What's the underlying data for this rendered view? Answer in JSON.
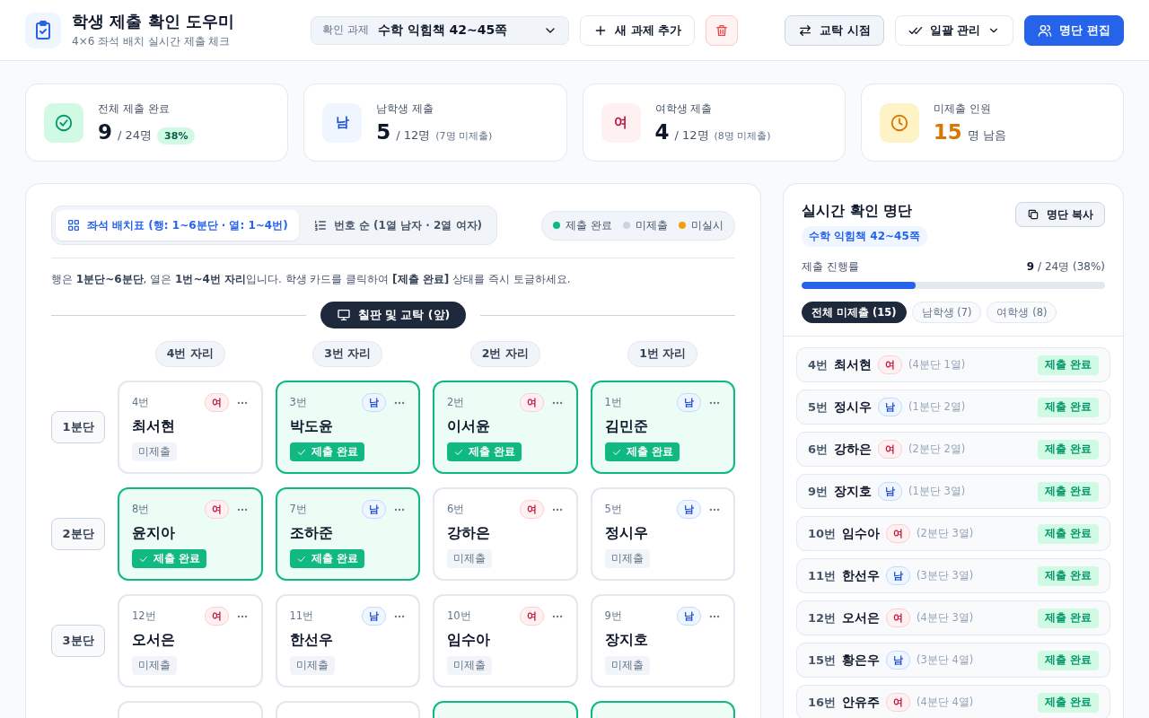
{
  "header": {
    "title": "학생 제출 확인 도우미",
    "subtitle": "4×6 좌석 배치 실시간 제출 체크",
    "assignment_select": {
      "label": "확인 과제",
      "value": "수학 익힘책 42~45쪽"
    },
    "buttons": [
      {
        "kind": "outline",
        "label": "새 과제 추가"
      },
      {
        "kind": "danger"
      },
      {
        "kind": "spacer"
      },
      {
        "kind": "soft",
        "label": "교탁 시점"
      },
      {
        "kind": "dropdown",
        "label": "일괄 관리"
      },
      {
        "kind": "primary",
        "label": "명단 편집"
      }
    ]
  },
  "stats": [
    {
      "kind": "check",
      "label": "전체 제출 완료",
      "value": "9",
      "total": "/ 24명",
      "percent": "38%"
    },
    {
      "kind": "male",
      "badge": "남",
      "label": "남학생 제출",
      "value": "5",
      "total": "/ 12명",
      "note": "(7명 미제출)"
    },
    {
      "kind": "female",
      "badge": "여",
      "label": "여학생 제출",
      "value": "4",
      "total": "/ 12명",
      "note": "(8명 미제출)"
    },
    {
      "kind": "clock",
      "label": "미제출 인원",
      "value": "15",
      "total": "명 남음"
    }
  ],
  "seating": {
    "view_tabs": [
      {
        "kind": "grid",
        "label": "좌석 배치표 (행: 1~6분단 · 열: 1~4번)",
        "selected": true
      },
      {
        "kind": "list",
        "label": "번호 순 (1열 남자 · 2열 여자)",
        "selected": false
      }
    ],
    "legend": [
      {
        "label": "제출 완료",
        "color": "#10b981"
      },
      {
        "label": "미제출",
        "color": "#cbd5e1"
      },
      {
        "label": "미실시",
        "color": "#f59e0b"
      }
    ],
    "instructions": "행은 **1분단~6분단**, 열은 **1번~4번 자리**입니다. 학생 카드를 클릭하여 **[제출 완료]** 상태를 즉시 토글하세요.",
    "front_label": "칠판 및 교탁 (앞)",
    "columns": [
      "4번 자리",
      "3번 자리",
      "2번 자리",
      "1번 자리"
    ],
    "rows": [
      {
        "label": "1분단",
        "seats": [
          {
            "number": "4번",
            "kind": "female",
            "badge": "여",
            "name": "최서현",
            "status": "미제출",
            "submitted": false
          },
          {
            "number": "3번",
            "kind": "male",
            "badge": "남",
            "name": "박도윤",
            "status": "제출 완료",
            "submitted": true
          },
          {
            "number": "2번",
            "kind": "female",
            "badge": "여",
            "name": "이서윤",
            "status": "제출 완료",
            "submitted": true
          },
          {
            "number": "1번",
            "kind": "male",
            "badge": "남",
            "name": "김민준",
            "status": "제출 완료",
            "submitted": true
          }
        ]
      },
      {
        "label": "2분단",
        "seats": [
          {
            "number": "8번",
            "kind": "female",
            "badge": "여",
            "name": "윤지아",
            "status": "제출 완료",
            "submitted": true
          },
          {
            "number": "7번",
            "kind": "male",
            "badge": "남",
            "name": "조하준",
            "status": "제출 완료",
            "submitted": true
          },
          {
            "number": "6번",
            "kind": "female",
            "badge": "여",
            "name": "강하은",
            "status": "미제출",
            "submitted": false
          },
          {
            "number": "5번",
            "kind": "male",
            "badge": "남",
            "name": "정시우",
            "status": "미제출",
            "submitted": false
          }
        ]
      },
      {
        "label": "3분단",
        "seats": [
          {
            "number": "12번",
            "kind": "female",
            "badge": "여",
            "name": "오서은",
            "status": "미제출",
            "submitted": false
          },
          {
            "number": "11번",
            "kind": "male",
            "badge": "남",
            "name": "한선우",
            "status": "미제출",
            "submitted": false
          },
          {
            "number": "10번",
            "kind": "female",
            "badge": "여",
            "name": "임수아",
            "status": "미제출",
            "submitted": false
          },
          {
            "number": "9번",
            "kind": "male",
            "badge": "남",
            "name": "장지호",
            "status": "미제출",
            "submitted": false
          }
        ]
      },
      {
        "seats": [
          {
            "submitted": false
          },
          {
            "submitted": false
          },
          {
            "submitted": true
          },
          {
            "submitted": true
          }
        ]
      }
    ]
  },
  "roster": {
    "title": "실시간 확인 명단",
    "copy_button": "명단 복사",
    "subject": "수학 익힘책 42~45쪽",
    "progress_label": "제출 진행률",
    "progress_text": "**9** / 24명 (38%)",
    "level": 0.375,
    "filters": [
      {
        "label": "전체 미제출 (15)",
        "selected": true
      },
      {
        "label": "남학생 (7)",
        "selected": false
      },
      {
        "label": "여학생 (8)",
        "selected": false
      }
    ],
    "items": [
      {
        "number": "4번",
        "name": "최서현",
        "kind": "female",
        "badge": "여",
        "seat": "(4분단 1열)",
        "action": "제출 완료"
      },
      {
        "number": "5번",
        "name": "정시우",
        "kind": "male",
        "badge": "남",
        "seat": "(1분단 2열)",
        "action": "제출 완료"
      },
      {
        "number": "6번",
        "name": "강하은",
        "kind": "female",
        "badge": "여",
        "seat": "(2분단 2열)",
        "action": "제출 완료"
      },
      {
        "number": "9번",
        "name": "장지호",
        "kind": "male",
        "badge": "남",
        "seat": "(1분단 3열)",
        "action": "제출 완료"
      },
      {
        "number": "10번",
        "name": "임수아",
        "kind": "female",
        "badge": "여",
        "seat": "(2분단 3열)",
        "action": "제출 완료"
      },
      {
        "number": "11번",
        "name": "한선우",
        "kind": "male",
        "badge": "남",
        "seat": "(3분단 3열)",
        "action": "제출 완료"
      },
      {
        "number": "12번",
        "name": "오서은",
        "kind": "female",
        "badge": "여",
        "seat": "(4분단 3열)",
        "action": "제출 완료"
      },
      {
        "number": "15번",
        "name": "황은우",
        "kind": "male",
        "badge": "남",
        "seat": "(3분단 4열)",
        "action": "제출 완료"
      },
      {
        "number": "16번",
        "name": "안유주",
        "kind": "female",
        "badge": "여",
        "seat": "(4분단 4열)",
        "action": "제출 완료"
      }
    ]
  }
}
